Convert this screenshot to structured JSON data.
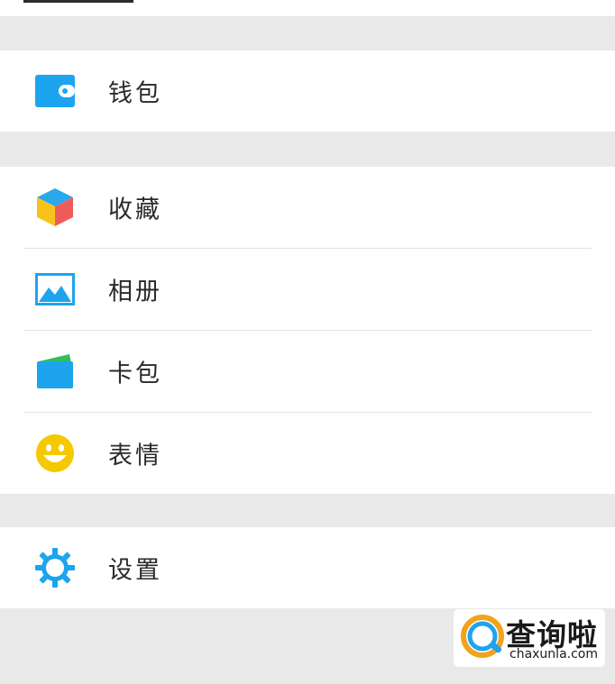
{
  "menu": {
    "wallet": {
      "label": "钱包",
      "icon": "wallet-icon"
    },
    "items": [
      {
        "label": "收藏",
        "icon": "favorites-cube-icon"
      },
      {
        "label": "相册",
        "icon": "album-photo-icon"
      },
      {
        "label": "卡包",
        "icon": "card-package-icon"
      },
      {
        "label": "表情",
        "icon": "sticker-smiley-icon"
      }
    ],
    "settings": {
      "label": "设置",
      "icon": "gear-icon"
    }
  },
  "watermark": {
    "title": "查询啦",
    "domain": "chaxunla.com",
    "logo": "chaxunla-logo-icon"
  },
  "colors": {
    "page_bg": "#e9e9e9",
    "row_bg": "#ffffff",
    "icon_blue": "#1da4ef",
    "divider": "#e2e2e2",
    "smiley_yellow": "#f5c800",
    "card_green": "#2ec05a"
  }
}
